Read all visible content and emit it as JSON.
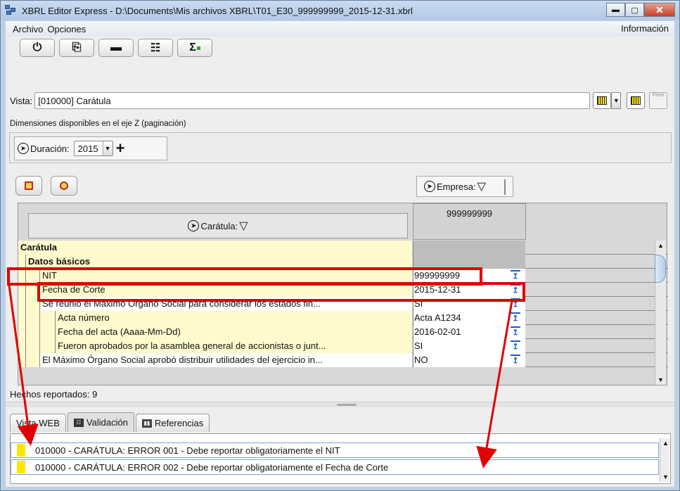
{
  "window": {
    "title": "XBRL Editor Express - D:\\Documents\\Mis archivos XBRL\\T01_E30_999999999_2015-12-31.xbrl",
    "minimize": "▬",
    "maximize": "▢",
    "close": "✕"
  },
  "menu": {
    "items": [
      "Archivo",
      "Opciones"
    ],
    "info": "Información"
  },
  "toolbar": {
    "buttons": [
      {
        "icon": "power-icon",
        "glyph": "⏻"
      },
      {
        "icon": "export-icon",
        "glyph": "⎘"
      },
      {
        "icon": "stamp-icon",
        "glyph": "▬"
      },
      {
        "icon": "form-list-icon",
        "glyph": "☷"
      },
      {
        "icon": "sigma-icon",
        "glyph": "Σ"
      }
    ]
  },
  "vista": {
    "label": "Vista:",
    "value": "[010000] Carátula",
    "form_icon_text": "Form"
  },
  "dimensions": {
    "label": "Dimensiones disponibles en el eje Z (paginación)",
    "duracion_label": "Duración:",
    "year": "2015",
    "plus": "+"
  },
  "empresa": {
    "label": "Empresa:"
  },
  "table": {
    "row_header": "Carátula:",
    "column_header": "999999999",
    "rows": [
      {
        "label": "Carátula",
        "value": "",
        "indent": 0,
        "bold": true,
        "bg": "#fffacd",
        "arrow": false
      },
      {
        "label": "Datos básicos",
        "value": "",
        "indent": 1,
        "bold": true,
        "bg": "#fffacd",
        "arrow": false
      },
      {
        "label": "NIT",
        "value": "999999999",
        "indent": 2,
        "bold": false,
        "bg": "#fffacd",
        "arrow": true
      },
      {
        "label": "Fecha de Corte",
        "value": "2015-12-31",
        "indent": 2,
        "bold": false,
        "bg": "#fffacd",
        "arrow": true
      },
      {
        "label": "Se reunió el Máximo Organo Social para considerar los estados fin...",
        "value": "SI",
        "indent": 2,
        "bold": false,
        "bg": "#ffffff",
        "arrow": true
      },
      {
        "label": "Acta número",
        "value": "Acta A1234",
        "indent": 3,
        "bold": false,
        "bg": "#fffacd",
        "arrow": true
      },
      {
        "label": "Fecha del acta (Aaaa-Mm-Dd)",
        "value": "2016-02-01",
        "indent": 3,
        "bold": false,
        "bg": "#fffacd",
        "arrow": true
      },
      {
        "label": "Fueron aprobados por la asamblea general de accionistas o junt...",
        "value": "SI",
        "indent": 3,
        "bold": false,
        "bg": "#fffacd",
        "arrow": true
      },
      {
        "label": "El Máximo Órgano Social aprobó distribuir utilidades del ejercicio in...",
        "value": "NO",
        "indent": 2,
        "bold": false,
        "bg": "#ffffff",
        "arrow": true
      }
    ]
  },
  "hechos": "Hechos reportados: 9",
  "tabs": [
    {
      "label": "Vista WEB",
      "active": false,
      "icon": ""
    },
    {
      "label": "Validación",
      "active": true,
      "icon": "validation-icon"
    },
    {
      "label": "Referencias",
      "active": false,
      "icon": "books-icon"
    }
  ],
  "messages": [
    "010000 - CARÁTULA: ERROR 001 - Debe reportar obligatoriamente el NIT",
    "010000 - CARÁTULA: ERROR 002 - Debe reportar obligatoriamente el Fecha de Corte"
  ],
  "colors": {
    "highlight": "#e00000",
    "error_flag": "#ffe600",
    "row_yellow": "#fffacd"
  }
}
